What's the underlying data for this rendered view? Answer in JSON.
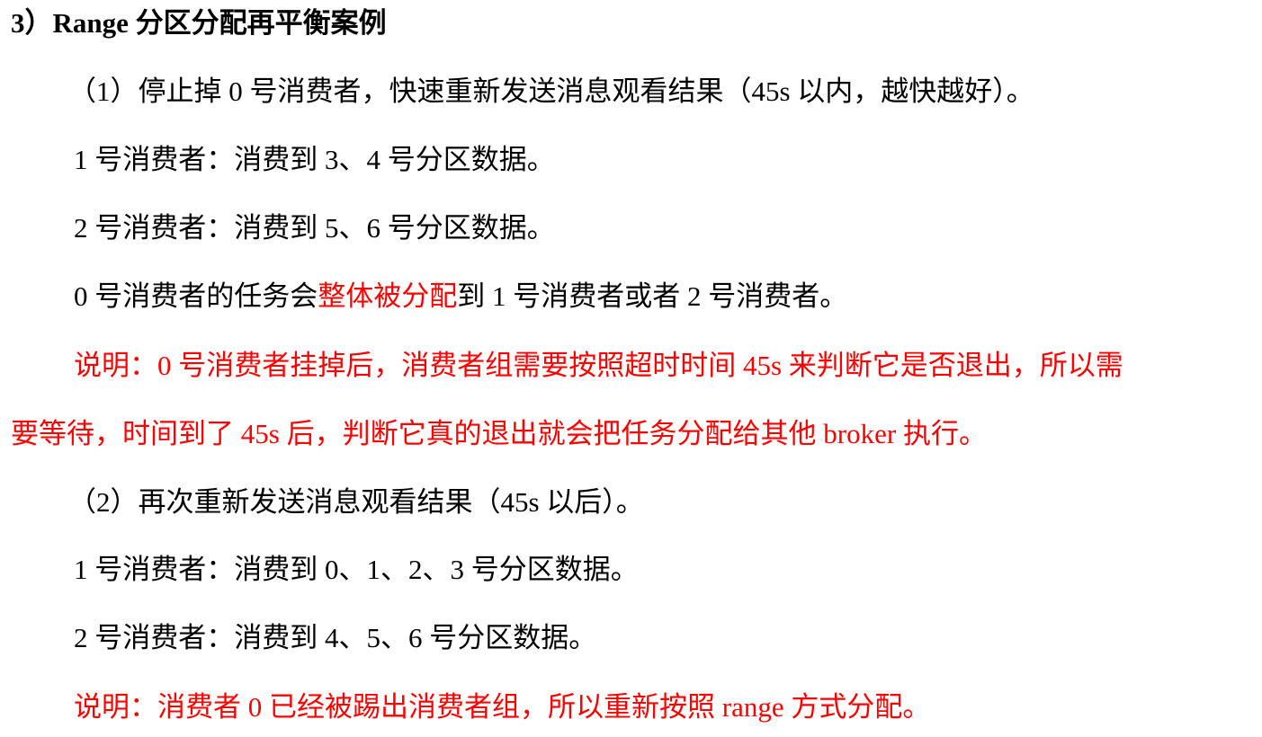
{
  "heading": "3）Range 分区分配再平衡案例",
  "p1": "（1）停止掉 0 号消费者，快速重新发送消息观看结果（45s 以内，越快越好）。",
  "p2": "1 号消费者：消费到 3、4 号分区数据。",
  "p3": "2 号消费者：消费到 5、6 号分区数据。",
  "p4": {
    "before": "0 号消费者的任务会",
    "highlight": "整体被分配",
    "after": "到 1 号消费者或者 2 号消费者。"
  },
  "note1_line1": "说明：0 号消费者挂掉后，消费者组需要按照超时时间 45s 来判断它是否退出，所以需",
  "note1_line2": "要等待，时间到了 45s 后，判断它真的退出就会把任务分配给其他 broker 执行。",
  "p5": "（2）再次重新发送消息观看结果（45s 以后）。",
  "p6": "1 号消费者：消费到 0、1、2、3 号分区数据。",
  "p7": "2 号消费者：消费到 4、5、6 号分区数据。",
  "note2": "说明：消费者 0 已经被踢出消费者组，所以重新按照 range 方式分配。",
  "colors": {
    "text": "#000000",
    "emphasis": "#ff0000"
  }
}
